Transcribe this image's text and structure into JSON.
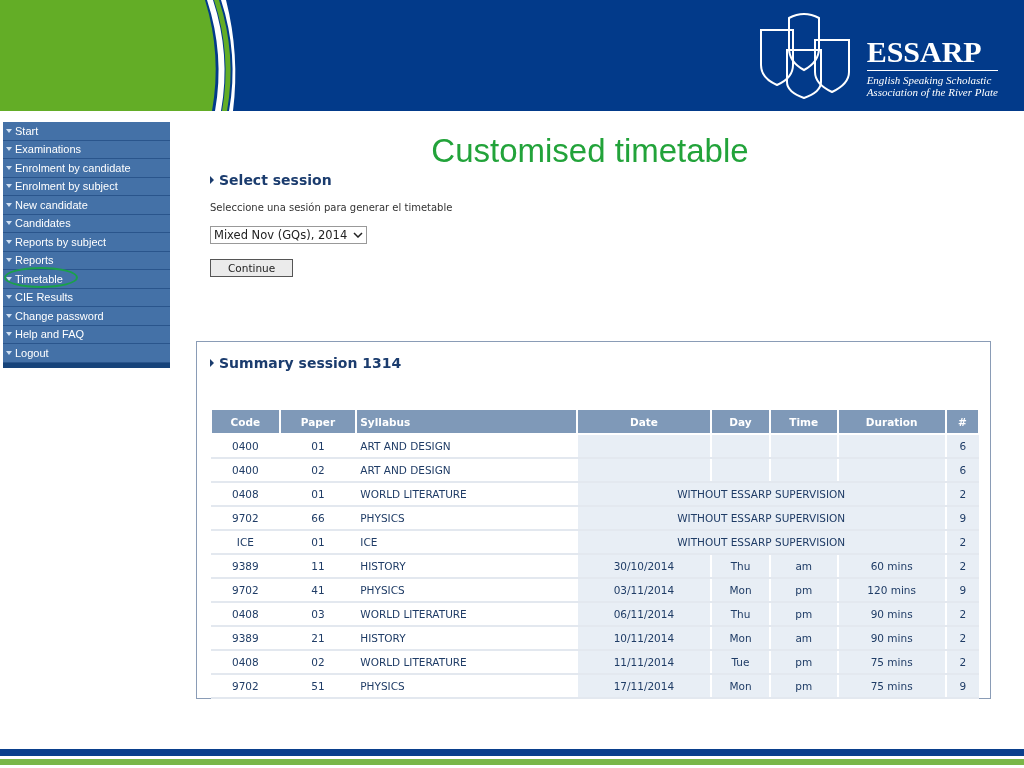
{
  "logo": {
    "name": "ESSARP",
    "tagline_1": "English Speaking Scholastic",
    "tagline_2": "Association of the River Plate"
  },
  "menu": [
    {
      "label": "Start",
      "circled": false
    },
    {
      "label": "Examinations",
      "circled": false
    },
    {
      "label": "Enrolment by candidate",
      "circled": false
    },
    {
      "label": "Enrolment by subject",
      "circled": false
    },
    {
      "label": "New candidate",
      "circled": false
    },
    {
      "label": "Candidates",
      "circled": false
    },
    {
      "label": "Reports by subject",
      "circled": false
    },
    {
      "label": "Reports",
      "circled": false
    },
    {
      "label": "Timetable",
      "circled": true
    },
    {
      "label": "CIE Results",
      "circled": false
    },
    {
      "label": "Change password",
      "circled": false
    },
    {
      "label": "Help and FAQ",
      "circled": false
    },
    {
      "label": "Logout",
      "circled": false
    }
  ],
  "title": "Customised timetable",
  "select_session": {
    "heading": "Select session",
    "instruction": "Seleccione una sesión para generar el timetable",
    "value": "Mixed Nov (GQs), 2014",
    "button": "Continue"
  },
  "summary": {
    "heading": "Summary session 1314",
    "columns": [
      "Code",
      "Paper",
      "Syllabus",
      "Date",
      "Day",
      "Time",
      "Duration",
      "#"
    ],
    "rows": [
      {
        "kind": "blank",
        "code": "0400",
        "paper": "01",
        "syllabus": "ART AND DESIGN",
        "count": "6"
      },
      {
        "kind": "blank",
        "code": "0400",
        "paper": "02",
        "syllabus": "ART AND DESIGN",
        "count": "6"
      },
      {
        "kind": "note",
        "code": "0408",
        "paper": "01",
        "syllabus": "WORLD LITERATURE",
        "note": "WITHOUT ESSARP SUPERVISION",
        "count": "2"
      },
      {
        "kind": "note",
        "code": "9702",
        "paper": "66",
        "syllabus": "PHYSICS",
        "note": "WITHOUT ESSARP SUPERVISION",
        "count": "9"
      },
      {
        "kind": "note",
        "code": "ICE",
        "paper": "01",
        "syllabus": "ICE",
        "note": "WITHOUT ESSARP SUPERVISION",
        "count": "2"
      },
      {
        "kind": "scheduled",
        "code": "9389",
        "paper": "11",
        "syllabus": "HISTORY",
        "date": "30/10/2014",
        "day": "Thu",
        "time": "am",
        "duration": "60 mins",
        "count": "2"
      },
      {
        "kind": "scheduled",
        "code": "9702",
        "paper": "41",
        "syllabus": "PHYSICS",
        "date": "03/11/2014",
        "day": "Mon",
        "time": "pm",
        "duration": "120 mins",
        "count": "9"
      },
      {
        "kind": "scheduled",
        "code": "0408",
        "paper": "03",
        "syllabus": "WORLD LITERATURE",
        "date": "06/11/2014",
        "day": "Thu",
        "time": "pm",
        "duration": "90 mins",
        "count": "2"
      },
      {
        "kind": "scheduled",
        "code": "9389",
        "paper": "21",
        "syllabus": "HISTORY",
        "date": "10/11/2014",
        "day": "Mon",
        "time": "am",
        "duration": "90 mins",
        "count": "2"
      },
      {
        "kind": "scheduled",
        "code": "0408",
        "paper": "02",
        "syllabus": "WORLD LITERATURE",
        "date": "11/11/2014",
        "day": "Tue",
        "time": "pm",
        "duration": "75 mins",
        "count": "2"
      },
      {
        "kind": "scheduled",
        "code": "9702",
        "paper": "51",
        "syllabus": "PHYSICS",
        "date": "17/11/2014",
        "day": "Mon",
        "time": "pm",
        "duration": "75 mins",
        "count": "9"
      }
    ]
  }
}
